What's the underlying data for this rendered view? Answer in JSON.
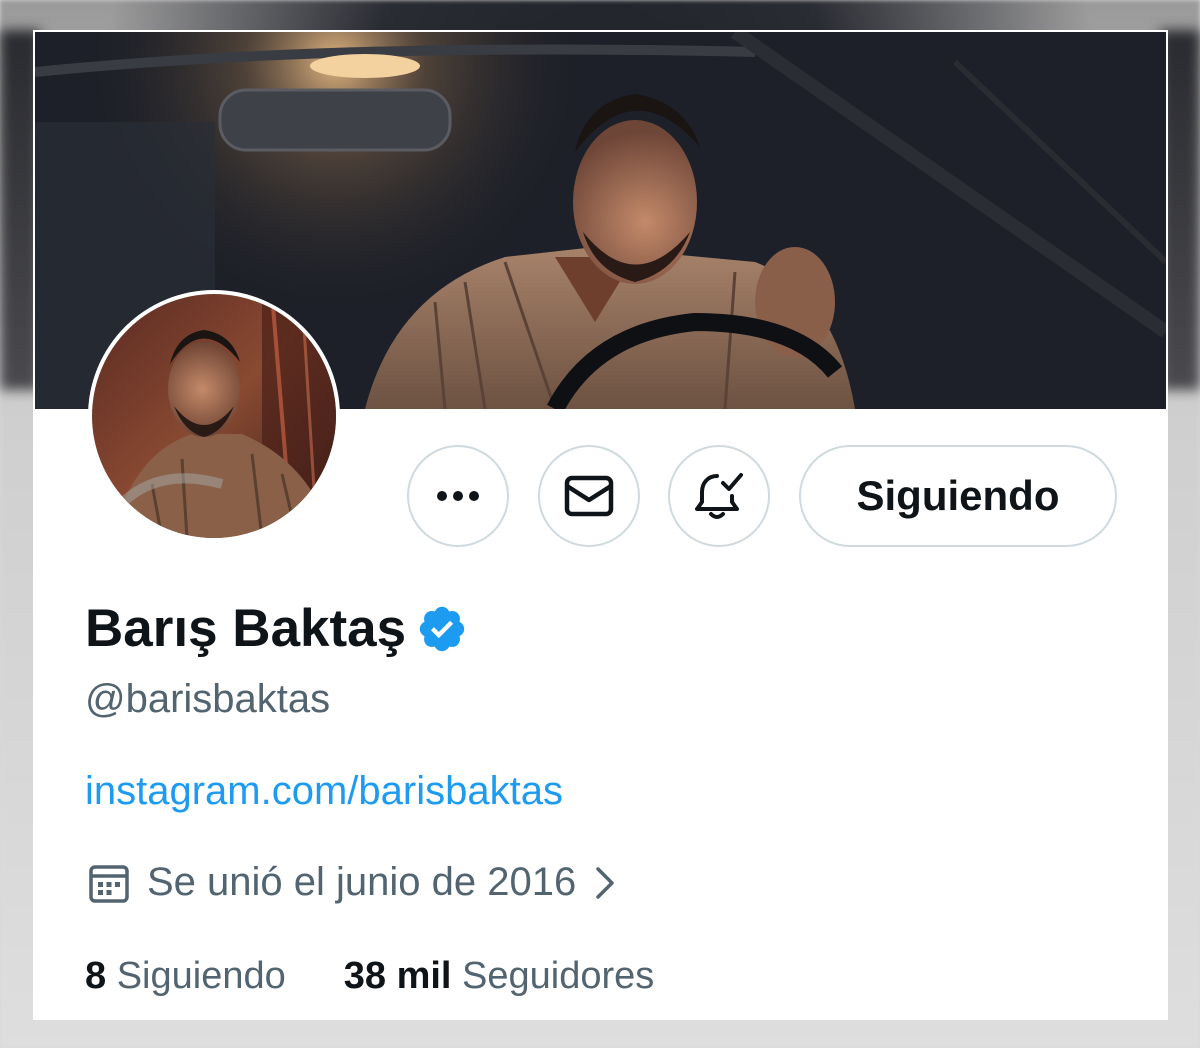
{
  "profile": {
    "display_name": "Barış Baktaş",
    "handle": "@barisbaktas",
    "link": "instagram.com/barisbaktas",
    "joined": "Se unió el junio de 2016",
    "verified_color": "#1d9bf0"
  },
  "actions": {
    "more_icon": "more-horizontal-icon",
    "message_icon": "envelope-icon",
    "notify_icon": "bell-check-icon",
    "follow_label": "Siguiendo"
  },
  "stats": {
    "following_count": "8",
    "following_label": "Siguiendo",
    "followers_count": "38 mil",
    "followers_label": "Seguidores"
  },
  "colors": {
    "text_primary": "#0f1419",
    "text_secondary": "#536471",
    "link": "#1d9bf0",
    "border": "#cfd9de"
  }
}
